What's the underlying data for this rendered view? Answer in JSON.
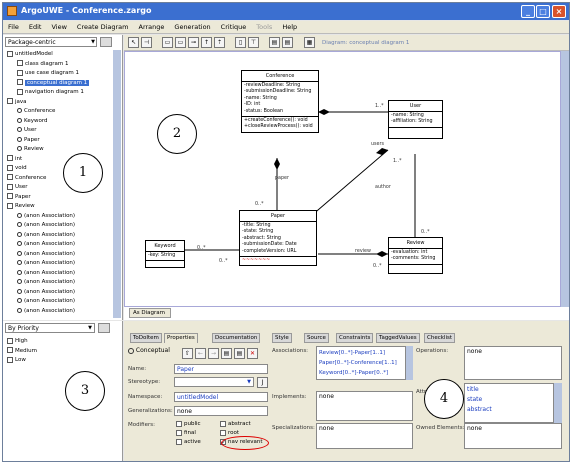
{
  "window": {
    "title": "ArgoUWE - Conference.zargo"
  },
  "menu": [
    "File",
    "Edit",
    "View",
    "Create Diagram",
    "Arrange",
    "Generation",
    "Critique",
    "Tools",
    "Help"
  ],
  "nav": {
    "perspective": "Package-centric",
    "tree": [
      {
        "label": "untitledModel"
      },
      {
        "label": "class diagram 1"
      },
      {
        "label": "use case diagram 1"
      },
      {
        "label": "conceptual diagram 1"
      },
      {
        "label": "navigation diagram 1"
      },
      {
        "label": "java"
      },
      {
        "label": "Conference"
      },
      {
        "label": "Keyword"
      },
      {
        "label": "User"
      },
      {
        "label": "Paper"
      },
      {
        "label": "Review"
      },
      {
        "label": "int"
      },
      {
        "label": "void"
      },
      {
        "label": "Conference"
      },
      {
        "label": "User"
      },
      {
        "label": "Paper"
      },
      {
        "label": "Review"
      },
      {
        "label": "(anon Association)"
      },
      {
        "label": "(anon Association)"
      },
      {
        "label": "(anon Association)"
      },
      {
        "label": "(anon Association)"
      },
      {
        "label": "(anon Association)"
      },
      {
        "label": "(anon Association)"
      },
      {
        "label": "(anon Association)"
      },
      {
        "label": "(anon Association)"
      },
      {
        "label": "(anon Association)"
      },
      {
        "label": "(anon Association)"
      },
      {
        "label": "(anon Association)"
      }
    ]
  },
  "diagram": {
    "label": "Diagram: conceptual diagram 1",
    "tab": "As Diagram",
    "classes": {
      "conference": {
        "name": "Conference",
        "attrs": [
          "-reviewDeadline: String",
          "-submissionDeadline: String",
          "-name: String",
          "-ID: int",
          "-status: Boolean"
        ],
        "ops": [
          "+createConference(): void",
          "+closeReviewProcess(): void"
        ]
      },
      "user": {
        "name": "User",
        "attrs": [
          "-name: String",
          "-affiliation: String"
        ]
      },
      "paper": {
        "name": "Paper",
        "attrs": [
          "-title: String",
          "-state: String",
          "-abstract: String",
          "-submissionDate: Date",
          "-completeVersion: URL"
        ]
      },
      "keyword": {
        "name": "Keyword",
        "attrs": [
          "-key: String"
        ]
      },
      "review": {
        "name": "Review",
        "attrs": [
          "-evaluation: int",
          "-comments: String"
        ]
      }
    },
    "labels": {
      "m1": "1..*",
      "m2": "1..*",
      "m3": "0..*",
      "m4": "0..*",
      "m5": "0..*",
      "m6": "0..*",
      "m7": "0..*",
      "users": "users",
      "author": "author",
      "paper": "paper",
      "review": "review"
    }
  },
  "todo": {
    "sort": "By Priority",
    "items": [
      "High",
      "Medium",
      "Low"
    ]
  },
  "props": {
    "tabs": [
      "ToDoItem",
      "Properties",
      "Documentation",
      "Style",
      "Source",
      "Constraints",
      "TaggedValues",
      "Checklist"
    ],
    "element": "Conceptual",
    "name_label": "Name:",
    "name": "Paper",
    "stereotype_label": "Stereotype:",
    "namespace_label": "Namespace:",
    "namespace": "untitledModel",
    "generalizations_label": "Generalizations:",
    "generalizations": "none",
    "modifiers_label": "Modifiers:",
    "mods": [
      "public",
      "abstract",
      "final",
      "root",
      "active",
      "nav relevant"
    ],
    "associations_label": "Associations:",
    "associations": [
      "Review[0..*]-Paper[1..1]",
      "Paper[0..*]-Conference[1..1]",
      "Keyword[0..*]-Paper[0..*]"
    ],
    "implements_label": "Implements:",
    "implements": "none",
    "specializations_label": "Specializations:",
    "specializations": "none",
    "operations_label": "Operations:",
    "operations": "none",
    "attributes_label": "Attributes:",
    "attributes": [
      "title",
      "state",
      "abstract"
    ],
    "owned_label": "Owned Elements:",
    "owned": "none"
  },
  "callouts": [
    "1",
    "2",
    "3",
    "4"
  ]
}
